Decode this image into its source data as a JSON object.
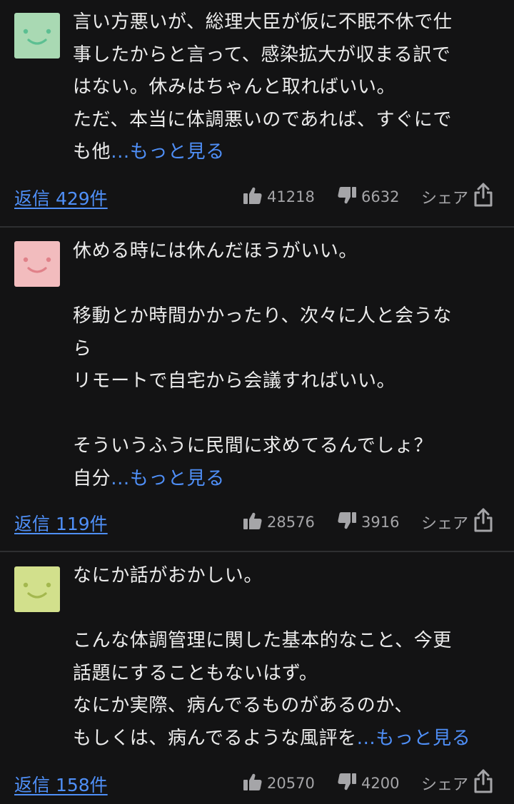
{
  "colors": {
    "background": "#131314",
    "text": "#ececec",
    "link": "#4f8ff7",
    "muted": "#a5a5a8",
    "divider": "#2e2f31"
  },
  "comments": [
    {
      "avatar": {
        "color": "#a9d9b3",
        "face_color": "#5cbf92",
        "icon": "smiley-face-icon"
      },
      "lines": [
        "言い方悪いが、総理大臣が仮に不眠不休で仕",
        "事したからと言って、感染拡大が収まる訳で",
        "はない。休みはちゃんと取ればいい。",
        "ただ、本当に体調悪いのであれば、すぐにで",
        "も他"
      ],
      "more": "...もっと見る",
      "replies": "返信 429件",
      "likes": "41218",
      "dislikes": "6632",
      "share": "シェア"
    },
    {
      "avatar": {
        "color": "#f2bcbe",
        "face_color": "#e08189",
        "icon": "smiley-face-icon"
      },
      "lines": [
        "休める時には休んだほうがいい。",
        "",
        "移動とか時間かかったり、次々に人と会うな",
        "ら",
        "リモートで自宅から会議すればいい。",
        "",
        "そういうふうに民間に求めてるんでしょ？",
        "自分"
      ],
      "more": "...もっと見る",
      "replies": "返信 119件",
      "likes": "28576",
      "dislikes": "3916",
      "share": "シェア"
    },
    {
      "avatar": {
        "color": "#d2e08c",
        "face_color": "#a4b84f",
        "icon": "smiley-face-icon"
      },
      "lines": [
        "なにか話がおかしい。",
        "",
        "こんな体調管理に関した基本的なこと、今更",
        "話題にすることもないはず。",
        "なにか実際、病んでるものがあるのか、",
        "もしくは、病んでるような風評を"
      ],
      "more": "...もっと見る",
      "replies": "返信 158件",
      "likes": "20570",
      "dislikes": "4200",
      "share": "シェア"
    }
  ]
}
